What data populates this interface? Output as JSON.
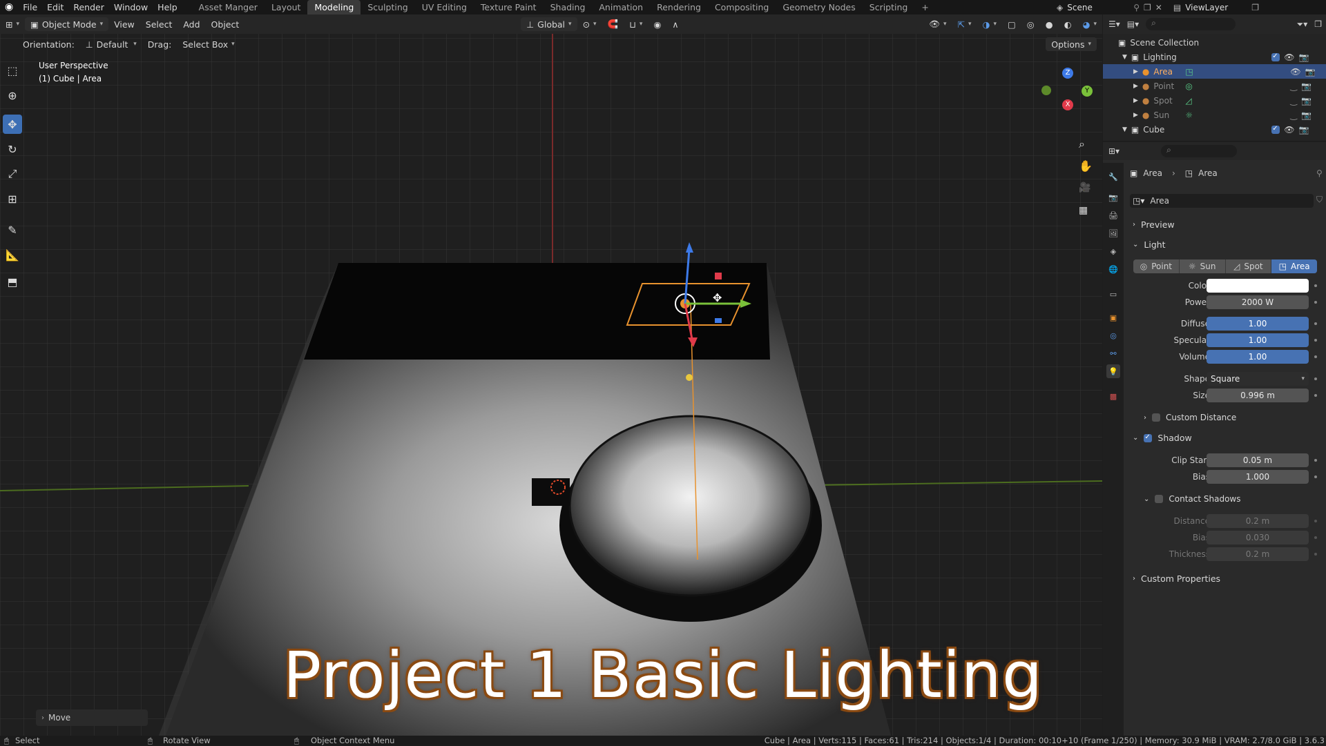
{
  "menus": [
    "File",
    "Edit",
    "Render",
    "Window",
    "Help"
  ],
  "workspaces": [
    "Asset Manger",
    "Layout",
    "Modeling",
    "Sculpting",
    "UV Editing",
    "Texture Paint",
    "Shading",
    "Animation",
    "Rendering",
    "Compositing",
    "Geometry Nodes",
    "Scripting"
  ],
  "active_workspace": "Modeling",
  "scene": {
    "label": "Scene",
    "view_layer": "ViewLayer"
  },
  "header": {
    "mode": "Object Mode",
    "view": "View",
    "select": "Select",
    "add": "Add",
    "object": "Object",
    "transform": "Global",
    "orientation_label": "Orientation:",
    "orientation": "Default",
    "drag_label": "Drag:",
    "drag": "Select Box",
    "options": "Options"
  },
  "viewport": {
    "perspective": "User Perspective",
    "context": "(1) Cube | Area",
    "title_overlay": "Project 1 Basic Lighting",
    "last_op": "Move",
    "gizmo": {
      "x": "X",
      "y": "Y",
      "z": "Z"
    }
  },
  "outliner": {
    "root": "Scene Collection",
    "items": [
      {
        "name": "Lighting"
      },
      {
        "name": "Area"
      },
      {
        "name": "Point"
      },
      {
        "name": "Spot"
      },
      {
        "name": "Sun"
      },
      {
        "name": "Cube"
      }
    ]
  },
  "properties": {
    "breadcrumb": [
      "Area",
      "Area"
    ],
    "datablock": "Area",
    "sections": {
      "preview": "Preview",
      "light": "Light",
      "custom_distance": "Custom Distance",
      "shadow": "Shadow",
      "contact_shadows": "Contact Shadows",
      "custom_properties": "Custom Properties"
    },
    "light_types": [
      "Point",
      "Sun",
      "Spot",
      "Area"
    ],
    "active_light_type": "Area",
    "fields": {
      "color_label": "Color",
      "power_label": "Power",
      "power": "2000 W",
      "diffuse_label": "Diffuse",
      "diffuse": "1.00",
      "specular_label": "Specular",
      "specular": "1.00",
      "volume_label": "Volume",
      "volume": "1.00",
      "shape_label": "Shape",
      "shape": "Square",
      "size_label": "Size",
      "size": "0.996 m",
      "clip_start_label": "Clip Start",
      "clip_start": "0.05 m",
      "bias_label": "Bias",
      "bias": "1.000",
      "distance_label": "Distance",
      "distance": "0.2 m",
      "cbias_label": "Bias",
      "cbias": "0.030",
      "thickness_label": "Thickness",
      "thickness": "0.2 m"
    },
    "light_color": "#ffffff"
  },
  "status": {
    "select": "Select",
    "rotate": "Rotate View",
    "context_menu": "Object Context Menu",
    "stats": "Cube | Area | Verts:115 | Faces:61 | Tris:214 | Objects:1/4 | Duration: 00:10+10 (Frame 1/250) | Memory: 30.9 MiB | VRAM: 2.7/8.0 GiB | 3.6.3"
  },
  "colors": {
    "accent": "#4772b3",
    "selected": "#334d80",
    "light_orange": "#e8922e"
  }
}
